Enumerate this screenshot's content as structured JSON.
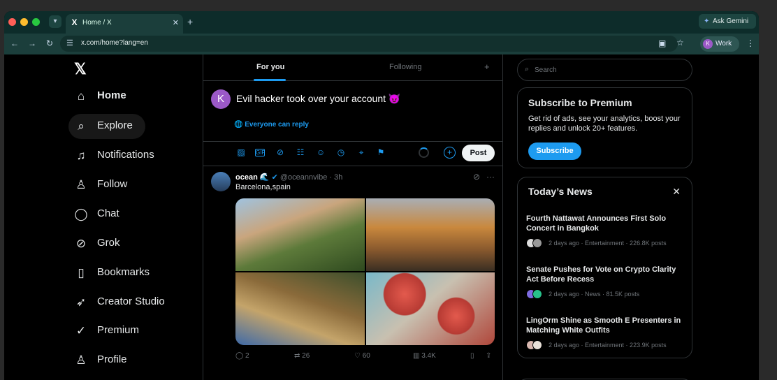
{
  "browser": {
    "tab_title": "Home / X",
    "tab_favicon": "X",
    "new_tab": "+",
    "ask_gemini": "Ask Gemini",
    "url": "x.com/home?lang=en",
    "profile_label": "Work",
    "profile_initial": "K",
    "traffic_lights": [
      "#ff5f57",
      "#febc2e",
      "#28c840"
    ]
  },
  "sidebar": {
    "logo": "𝕏",
    "items": [
      {
        "label": "Home",
        "icon": "home-icon",
        "glyph": "⌂"
      },
      {
        "label": "Explore",
        "icon": "search-icon",
        "glyph": "⌕"
      },
      {
        "label": "Notifications",
        "icon": "bell-icon",
        "glyph": "♫"
      },
      {
        "label": "Follow",
        "icon": "add-user-icon",
        "glyph": "♙"
      },
      {
        "label": "Chat",
        "icon": "chat-icon",
        "glyph": "◯"
      },
      {
        "label": "Grok",
        "icon": "grok-icon",
        "glyph": "⊘"
      },
      {
        "label": "Bookmarks",
        "icon": "bookmark-icon",
        "glyph": "▯"
      },
      {
        "label": "Creator Studio",
        "icon": "rocket-icon",
        "glyph": "➶"
      },
      {
        "label": "Premium",
        "icon": "verified-icon",
        "glyph": "✓"
      },
      {
        "label": "Profile",
        "icon": "person-icon",
        "glyph": "♙"
      }
    ]
  },
  "feed": {
    "tabs": [
      "For you",
      "Following"
    ],
    "tab_plus": "+",
    "compose": {
      "avatar_initial": "K",
      "text": "Evil hacker took over your account 😈",
      "reply_setting": "Everyone can reply",
      "post_label": "Post",
      "add_label": "+"
    },
    "tweet": {
      "name": "ocean 🌊",
      "handle": "@oceannvibe",
      "time": "3h",
      "text": "Barcelona,spain",
      "replies": "2",
      "reposts": "26",
      "likes": "60",
      "views": "3.4K"
    }
  },
  "right": {
    "search_placeholder": "Search",
    "premium": {
      "title": "Subscribe to Premium",
      "body": "Get rid of ads, see your analytics, boost your replies and unlock 20+ features.",
      "button": "Subscribe"
    },
    "news": {
      "title": "Today’s News",
      "items": [
        {
          "headline": "Fourth Nattawat Announces First Solo Concert in Bangkok",
          "meta": "2 days ago · Entertainment · 226.8K posts"
        },
        {
          "headline": "Senate Pushes for Vote on Crypto Clarity Act Before Recess",
          "meta": "2 days ago · News · 81.5K posts"
        },
        {
          "headline": "LingOrm Shine as Smooth E Presenters in Matching White Outfits",
          "meta": "2 days ago · Entertainment · 223.9K posts"
        }
      ]
    }
  },
  "colors": {
    "accent": "#1d9bf0",
    "background": "#000000",
    "border": "#2f3336"
  }
}
